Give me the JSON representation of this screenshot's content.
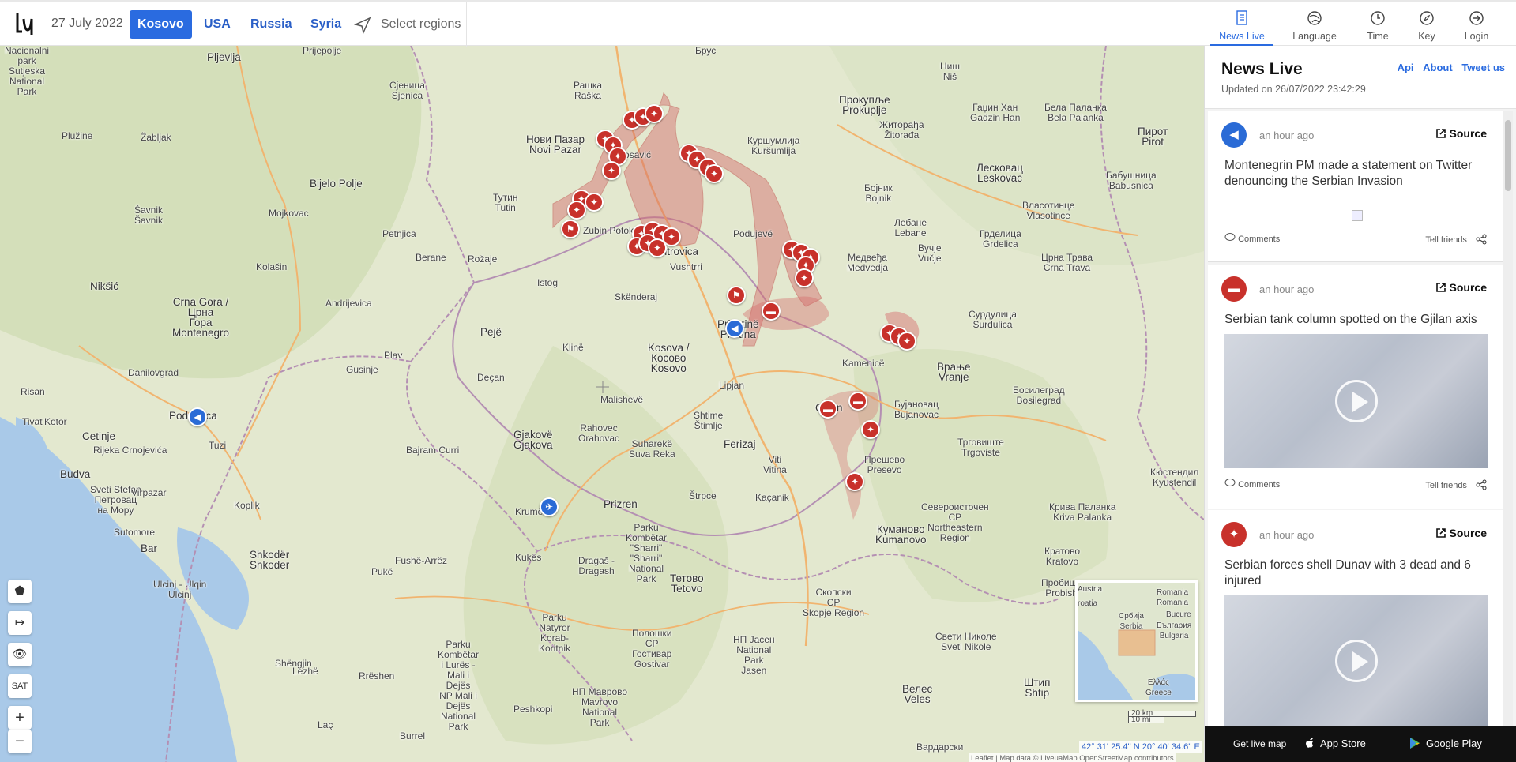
{
  "header": {
    "date": "27 July 2022",
    "regions": [
      {
        "label": "Kosovo",
        "active": true
      },
      {
        "label": "USA",
        "active": false
      },
      {
        "label": "Russia",
        "active": false
      },
      {
        "label": "Syria",
        "active": false
      }
    ],
    "select_regions": "Select regions",
    "nav": [
      {
        "label": "News Live",
        "icon": "news-icon",
        "active": true
      },
      {
        "label": "Language",
        "icon": "language-icon",
        "active": false
      },
      {
        "label": "Time",
        "icon": "clock-icon",
        "active": false
      },
      {
        "label": "Key",
        "icon": "compass-icon",
        "active": false
      },
      {
        "label": "Login",
        "icon": "login-icon",
        "active": false
      }
    ]
  },
  "map": {
    "places": {
      "nacionalni_park": "Nacionalni\npark\nSutjeska\nNational\nPark",
      "pljevlja": "Pljevlja",
      "prijepolje": "Prijepolje",
      "sjenica": "Сјеница\nSjenica",
      "raska": "Рашка\nRaška",
      "brus": "Брус",
      "nis": "Ниш\nNiš",
      "novi_pazar": "Нови Пазар\nNovi Pazar",
      "leposavic": "Leposavić",
      "kursumlija": "Куршумлија\nKuršumlija",
      "prokuplje": "Прокупље\nProkuplje",
      "zitoradja": "Житорађа\nŽitorađa",
      "gadzin_han": "Гаџин Хан\nGadzin Han",
      "bela_palanka": "Бела Паланка\nBela Palanka",
      "pirot": "Пирот\nPirot",
      "pluzine": "Plužine",
      "zabljak": "Žabljak",
      "bijelo_polje": "Bijelo Polje",
      "tutin": "Тутин\nTutin",
      "zubin_potok": "Zubin Potok",
      "mitrovica": "Mitrovica",
      "podujeve": "Podujevë",
      "bojnik": "Бојник\nBojnik",
      "lebane": "Лебане\nLebane",
      "leskovac": "Лесковац\nLeskovac",
      "vlasotince": "Власотинце\nVlasotince",
      "babusnica": "Бабушница\nBabusnica",
      "savnik": "Šavnik\nŠavnik",
      "mojkovac": "Mojkovac",
      "petnjica": "Petnjica",
      "berane": "Berane",
      "rozaje": "Rožaje",
      "vushtrri": "Vushtrri",
      "medvedja": "Медвеђа\nMedvedja",
      "vucje": "Вучје\nVučje",
      "crna_trava": "Црна Трава\nCrna Trava",
      "grdelica": "Грделица\nGrdelica",
      "kolasin": "Kolašin",
      "niksic": "Nikšić",
      "andrijevica": "Andrijevica",
      "istog": "Istog",
      "skenderaj": "Skënderaj",
      "pristina": "Prishtinë\nPriština",
      "crna_gora": "Crna Gora /\nЦрна\nГора\nMontenegro",
      "plav": "Plav",
      "peje": "Pejë",
      "kline": "Klinë",
      "kosovo": "Kosova /\nКосово\nKosovo",
      "surdulica": "Сурдулица\nSurdulica",
      "vranje": "Врање\nVranje",
      "kamenice": "Kamenicë",
      "danilovgrad": "Danilovgrad",
      "gusinje": "Gusinje",
      "decan": "Deçan",
      "malisheve": "Malishevë",
      "lipjan": "Lipjan",
      "risan": "Risan",
      "kotor": "Kotor",
      "tivat": "Tivat",
      "cetinje": "Cetinje",
      "podgorica": "Podgorica",
      "tuzi": "Tuzi",
      "gjakove": "Gjakovë\nGjakova",
      "rahovec": "Rahovec\nOrahovac",
      "suhareke": "Suharekë\nSuva Reka",
      "shtime": "Shtime\nŠtimlje",
      "ferizaj": "Ferizaj",
      "gjilan": "Gjilan",
      "bujanovac": "Бујановац\nBujanovac",
      "bosilegrad": "Босилеград\nBosilegrad",
      "trgoviste": "Трговиште\nTrgoviste",
      "rijeka": "Rijeka Crnojevića",
      "bajram_curri": "Bajram Curri",
      "budva": "Budva",
      "sveti_stefan": "Sveti Stefan\nПетровац\nна Мору",
      "virpazar": "Virpazar",
      "viti": "Viti\nVitina",
      "presevo": "Прешево\nPresevo",
      "krume": "Krumë",
      "prizren": "Prizren",
      "shtrpce": "Štrpce",
      "kacanik": "Kaçanik",
      "kjustendil": "Кюстендил\nKyustendil",
      "koplik": "Koplik",
      "sutomore": "Sutomore",
      "bar": "Bar",
      "shkoder": "Shkodër\nShkoder",
      "fushe_arrez": "Fushë-Arrëz",
      "kukes": "Kukës",
      "dragas": "Dragaš -\nDragash",
      "sharri": "Parku\nKombëtar\n\"Sharri\"\n\"Sharri\"\nNational\nPark",
      "tetovo": "Тетово\nTetovo",
      "severoistochen": "Североисточен\nCP\nNortheastern\nRegion",
      "kumanovo": "Куманово\nKumanovo",
      "kriva_palanka": "Крива Паланка\nKriva Palanka",
      "kratovo": "Кратово\nKratovo",
      "ulcinj": "Ulcinj - Ulqin\nUlcinj",
      "puke": "Pukë",
      "korab": "Parku\nNatyror\nKorab-\nKoritnik",
      "polog": "Полошки\nCP\nГостивар\nGostivar",
      "skopje": "Скопски\nCP\nSkopje Region",
      "jasen": "НП Јасен\nNational\nPark\nJasen",
      "probistip": "Пробиштип\nProbishtip",
      "sveti_nikole": "Свети Николе\nSveti Nikole",
      "shengjin": "Shëngjin",
      "lezhe": "Lezhë",
      "rreshen": "Rrëshen",
      "lures": "Parku\nKombëtar\ni Lurës -\nMali i\nDejës\nNP Mali i\nDejës\nNational\nPark",
      "mavrovo": "НП Маврово\nMavrovo\nNational\nPark",
      "peshkopi": "Peshkopi",
      "veles": "Велес\nVeles",
      "stip": "Штип\nShtip",
      "lac": "Laç",
      "burrel": "Burrel",
      "vardarski": "Вардарски"
    },
    "minimap_labels": {
      "austria": "Austria",
      "srbija": "Србија\nSerbia",
      "romania": "Romania\nRomania",
      "bucure": "Bucure",
      "balgaria": "България\nBulgaria",
      "croatia": "roatia",
      "ellas": "Ελλάς\nGreece"
    },
    "scale_km": "20 km",
    "scale_mi": "10 mi",
    "coords": "42° 31' 25.4'' N 20° 40' 34.6'' E",
    "attribution": "Leaflet | Map data © LiveuaMap OpenStreetMap contributors",
    "controls": {
      "polygon": "⬟",
      "measure": "↦",
      "hide": "👁",
      "sat": "SAT",
      "zoom_in": "+",
      "zoom_out": "−"
    }
  },
  "panel": {
    "title": "News Live",
    "updated": "Updated on 26/07/2022 23:42:29",
    "links": [
      "Api",
      "About",
      "Tweet us"
    ],
    "items": [
      {
        "time": "an hour ago",
        "source": "Source",
        "text": "Montenegrin PM made a statement on Twitter denouncing the Serbian Invasion",
        "icon": "megaphone-icon",
        "color": "#2a6bd6",
        "comments": "Comments",
        "tell": "Tell friends"
      },
      {
        "time": "an hour ago",
        "source": "Source",
        "text": "Serbian tank column spotted on the Gjilan axis",
        "icon": "tank-icon",
        "color": "#c8312b",
        "comments": "Comments",
        "tell": "Tell friends"
      },
      {
        "time": "an hour ago",
        "source": "Source",
        "text": "Serbian forces shell Dunav with 3 dead and 6 injured",
        "icon": "shell-icon",
        "color": "#c8312b",
        "comments": "Comments",
        "tell": "Tell friends"
      }
    ],
    "apps": {
      "get": "Get live map",
      "appstore": "App Store",
      "googleplay": "Google Play"
    }
  },
  "colors": {
    "accent": "#2a6be0",
    "marker_red": "#c8312b",
    "marker_blue": "#2a6bd6"
  }
}
